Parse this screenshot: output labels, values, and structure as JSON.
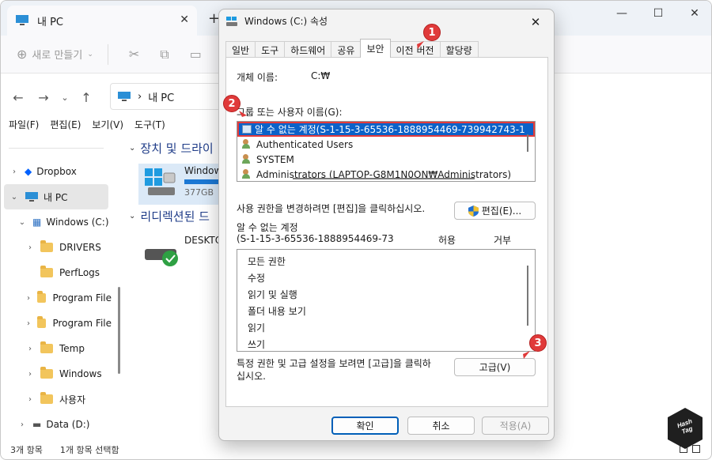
{
  "explorer": {
    "tab_title": "내 PC",
    "new_button": "새로 만들기",
    "address": "내 PC",
    "menu": [
      "파일(F)",
      "편집(E)",
      "보기(V)",
      "도구(T)"
    ],
    "sidebar": [
      {
        "label": "Dropbox",
        "chevron": "›"
      },
      {
        "label": "내 PC",
        "chevron": "⌄"
      },
      {
        "label": "Windows (C:)",
        "chevron": "⌄"
      },
      {
        "label": "DRIVERS",
        "chevron": "›"
      },
      {
        "label": "PerfLogs",
        "chevron": ""
      },
      {
        "label": "Program File",
        "chevron": "›"
      },
      {
        "label": "Program File",
        "chevron": "›"
      },
      {
        "label": "Temp",
        "chevron": "›"
      },
      {
        "label": "Windows",
        "chevron": "›"
      },
      {
        "label": "사용자",
        "chevron": "›"
      },
      {
        "label": "Data (D:)",
        "chevron": "›"
      }
    ],
    "section_devices": "장치 및 드라이",
    "drive_label": "Window",
    "drive_size": "377GB",
    "section_redirect": "리디렉션된 드",
    "desktop_label": "DESKTO",
    "status_count": "3개 항목",
    "status_selected": "1개 항목 선택함"
  },
  "dialog": {
    "title": "Windows (C:) 속성",
    "tabs": [
      "일반",
      "도구",
      "하드웨어",
      "공유",
      "보안",
      "이전 버전",
      "할당량"
    ],
    "active_tab": "보안",
    "object_name_label": "개체 이름:",
    "object_name_value": "C:₩",
    "groups_label": "그룹 또는 사용자 이름(G):",
    "groups": [
      "알 수 없는 계정(S-1-15-3-65536-1888954469-739942743-1",
      "Authenticated Users",
      "SYSTEM",
      "Administrators (LAPTOP-G8M1N0ON₩Administrators)"
    ],
    "change_text": "사용 권한을 변경하려면 [편집]을 클릭하십시오.",
    "edit_button": "편집(E)...",
    "perm_for_label_1": "알 수 없는 계정",
    "perm_for_label_2": "(S-1-15-3-65536-1888954469-73",
    "allow_header": "허용",
    "deny_header": "거부",
    "permissions": [
      "모든 권한",
      "수정",
      "읽기 및 실행",
      "폴더 내용 보기",
      "읽기",
      "쓰기"
    ],
    "advanced_text_1": "특정 권한 및 고급 설정을 보려면 [고급]을 클릭하",
    "advanced_text_2": "십시오.",
    "advanced_button": "고급(V)",
    "ok_button": "확인",
    "cancel_button": "취소",
    "apply_button": "적용(A)"
  },
  "annotations": {
    "badge1": "1",
    "badge2": "2",
    "badge3": "3",
    "watermark": "Hash Tag"
  },
  "colors": {
    "selection": "#0b62c9",
    "highlight_border": "#e33b3b",
    "badge": "#e03a3a"
  }
}
